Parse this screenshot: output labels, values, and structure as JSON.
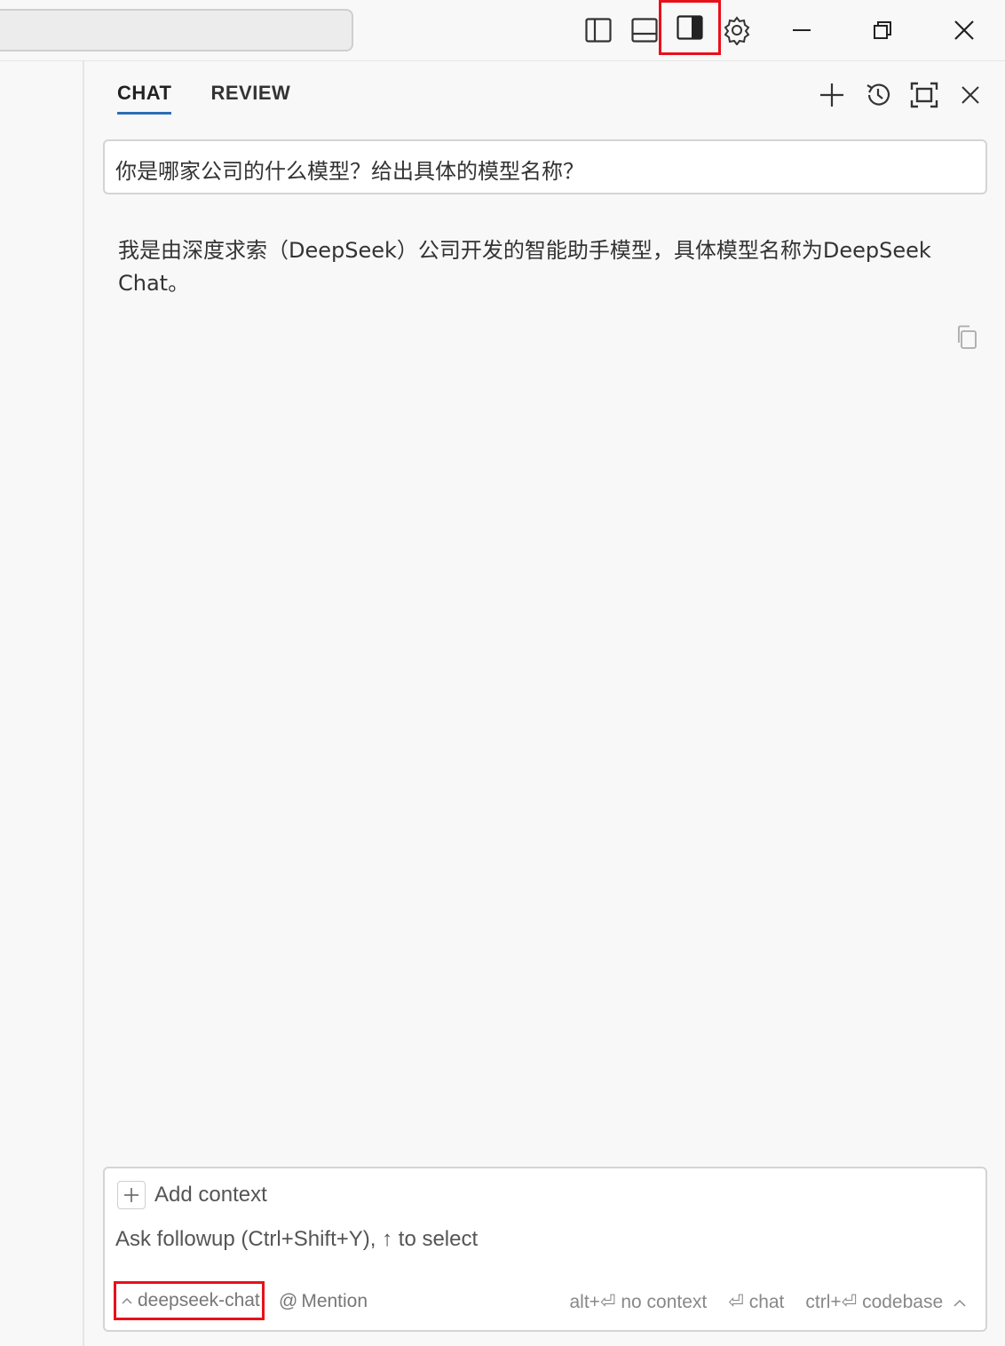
{
  "titlebar": {
    "icons": [
      "toggle-primary-sidebar-icon",
      "toggle-panel-icon",
      "toggle-secondary-sidebar-icon",
      "settings-gear-icon",
      "minimize-icon",
      "restore-icon",
      "close-icon"
    ]
  },
  "chat": {
    "tabs": [
      {
        "label": "CHAT",
        "active": true
      },
      {
        "label": "REVIEW",
        "active": false
      }
    ],
    "actions": [
      "new-chat-icon",
      "history-icon",
      "fullscreen-icon",
      "close-panel-icon"
    ],
    "user_message": "你是哪家公司的什么模型？给出具体的模型名称？",
    "assistant_message": "我是由深度求索（DeepSeek）公司开发的智能助手模型，具体模型名称为DeepSeek Chat。"
  },
  "input": {
    "add_context": "Add context",
    "placeholder": "Ask followup (Ctrl+Shift+Y), ↑ to select",
    "model": "deepseek-chat",
    "mention": "Mention",
    "shortcuts": {
      "no_context": "alt+⏎ no context",
      "chat": "⏎ chat",
      "codebase": "ctrl+⏎ codebase"
    }
  },
  "colors": {
    "accent_underline": "#2f6db5",
    "highlight_box": "#e8101a"
  }
}
